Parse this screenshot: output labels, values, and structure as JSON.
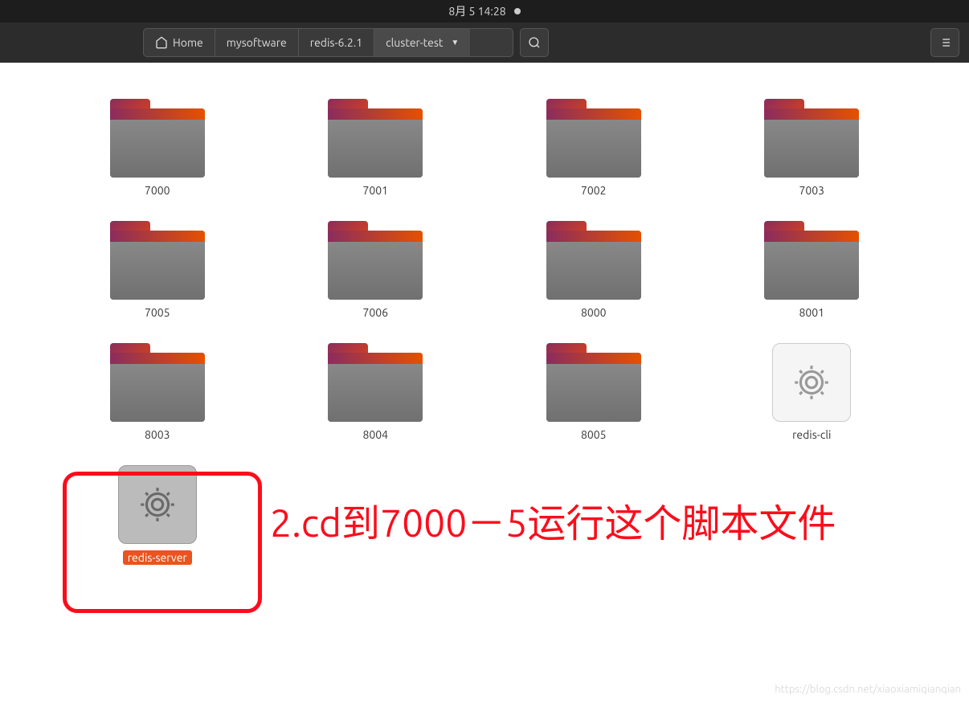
{
  "topbar": {
    "datetime": "8月 5 14:28"
  },
  "breadcrumb": {
    "home": "Home",
    "items": [
      "mysoftware",
      "redis-6.2.1",
      "cluster-test"
    ]
  },
  "files": [
    {
      "name": "7000",
      "type": "folder"
    },
    {
      "name": "7001",
      "type": "folder"
    },
    {
      "name": "7002",
      "type": "folder"
    },
    {
      "name": "7003",
      "type": "folder"
    },
    {
      "name": "7005",
      "type": "folder"
    },
    {
      "name": "7006",
      "type": "folder"
    },
    {
      "name": "8000",
      "type": "folder"
    },
    {
      "name": "8001",
      "type": "folder"
    },
    {
      "name": "8003",
      "type": "folder"
    },
    {
      "name": "8004",
      "type": "folder"
    },
    {
      "name": "8005",
      "type": "folder"
    },
    {
      "name": "redis-cli",
      "type": "exec"
    },
    {
      "name": "redis-server",
      "type": "exec",
      "selected": true
    }
  ],
  "annotation": {
    "text": "2.cd到7000－5运行这个脚本文件"
  },
  "watermark": "https://blog.csdn.net/xiaoxiamiqianqian"
}
